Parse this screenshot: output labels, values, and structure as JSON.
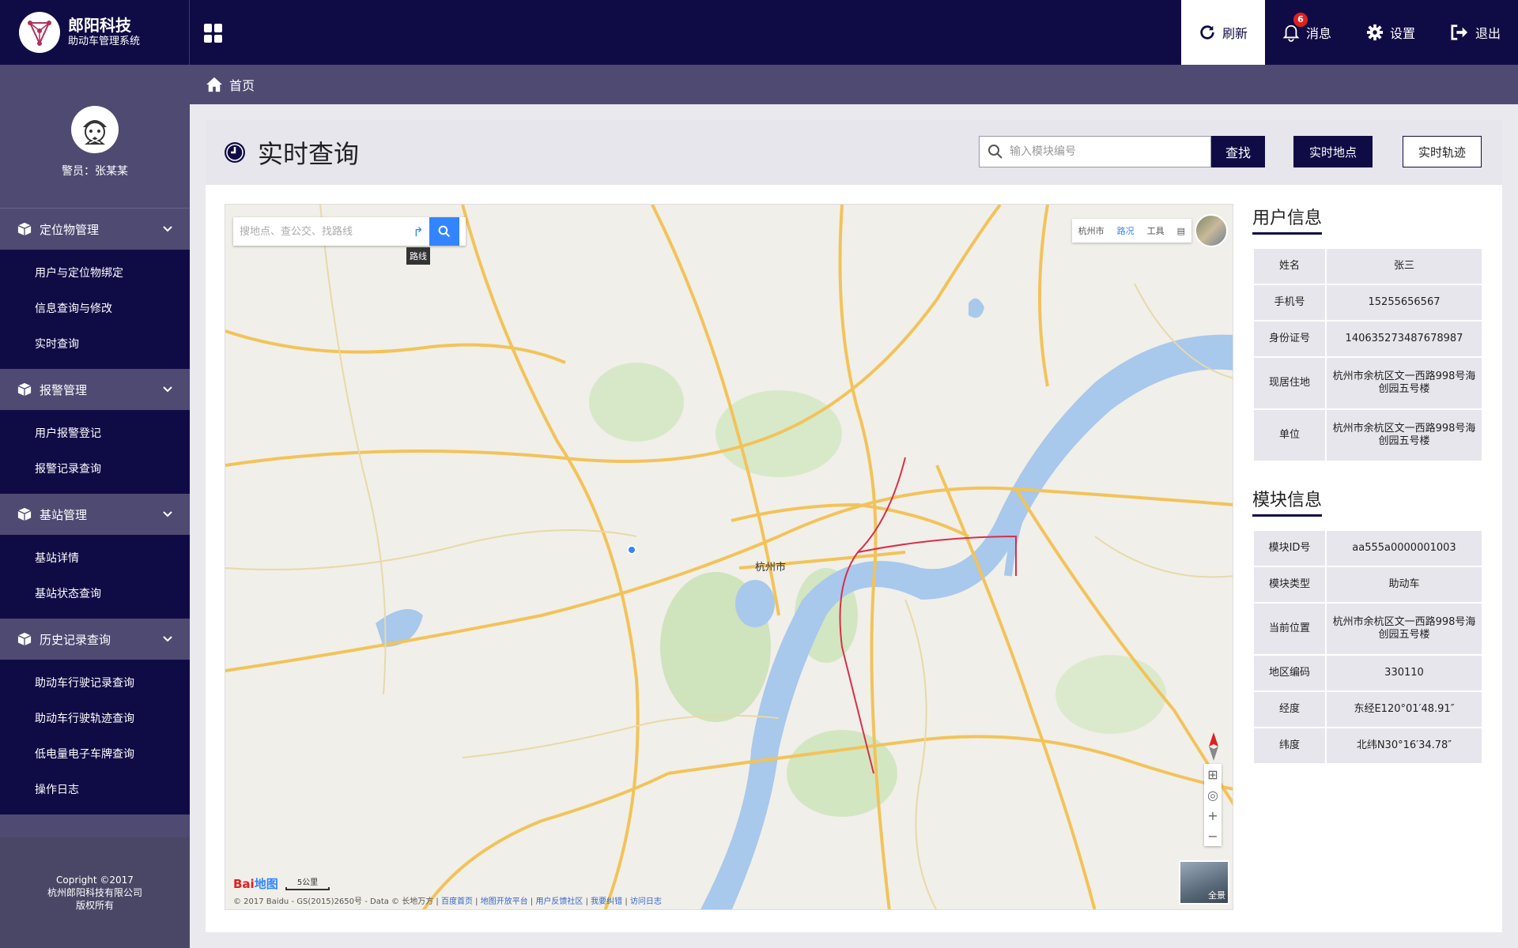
{
  "brand": {
    "name": "郎阳科技",
    "subtitle": "助动车管理系统"
  },
  "topbar": {
    "refresh_label": "刷新",
    "messages_label": "消息",
    "messages_count": "6",
    "settings_label": "设置",
    "logout_label": "退出"
  },
  "profile": {
    "name": "警员：张某某"
  },
  "sidebar": {
    "groups": [
      {
        "title": "定位物管理",
        "items": [
          "用户与定位物绑定",
          "信息查询与修改",
          "实时查询"
        ]
      },
      {
        "title": "报警管理",
        "items": [
          "用户报警登记",
          "报警记录查询"
        ]
      },
      {
        "title": "基站管理",
        "items": [
          "基站详情",
          "基站状态查询"
        ]
      },
      {
        "title": "历史记录查询",
        "items": [
          "助动车行驶记录查询",
          "助动车行驶轨迹查询",
          "低电量电子车牌查询",
          "操作日志"
        ]
      }
    ],
    "footer": {
      "line1": "Copright ©2017",
      "line2": "杭州郎阳科技有限公司",
      "line3": "版权所有"
    }
  },
  "breadcrumb": {
    "home": "首页"
  },
  "page": {
    "title": "实时查询",
    "search_placeholder": "输入模块编号",
    "find_label": "查找",
    "realtime_location_label": "实时地点",
    "realtime_track_label": "实时轨迹"
  },
  "map": {
    "search_placeholder": "搜地点、查公交、找路线",
    "route_tip": "路线",
    "toolbar": {
      "city": "杭州市",
      "traffic": "路况",
      "tools": "工具"
    },
    "city_label": "杭州市",
    "scale": "5公里",
    "street_view": "全景",
    "logo": "Bai",
    "logo_suffix": "地图",
    "copyright": "© 2017 Baidu - GS(2015)2650号 - Data © 长地万方",
    "copyright_links": [
      "百度首页",
      "地图开放平台",
      "用户反馈社区",
      "我要纠错",
      "访问日志"
    ]
  },
  "user_info": {
    "title": "用户信息",
    "rows": [
      {
        "label": "姓名",
        "value": "张三"
      },
      {
        "label": "手机号",
        "value": "15255656567"
      },
      {
        "label": "身份证号",
        "value": "140635273487678987"
      },
      {
        "label": "现居住地",
        "value": "杭州市余杭区文一西路998号海创园五号楼"
      },
      {
        "label": "单位",
        "value": "杭州市余杭区文一西路998号海创园五号楼"
      }
    ]
  },
  "module_info": {
    "title": "模块信息",
    "rows": [
      {
        "label": "模块ID号",
        "value": "aa555a0000001003"
      },
      {
        "label": "模块类型",
        "value": "助动车"
      },
      {
        "label": "当前位置",
        "value": "杭州市余杭区文一西路998号海创园五号楼"
      },
      {
        "label": "地区编码",
        "value": "330110"
      },
      {
        "label": "经度",
        "value": "东经E120°01′48.91″"
      },
      {
        "label": "纬度",
        "value": "北纬N30°16′34.78″"
      }
    ]
  },
  "colors": {
    "navy": "#0f0c45",
    "sidebar": "#4e4a72",
    "panel": "#e6e6ec",
    "map_blue": "#3385ff"
  }
}
